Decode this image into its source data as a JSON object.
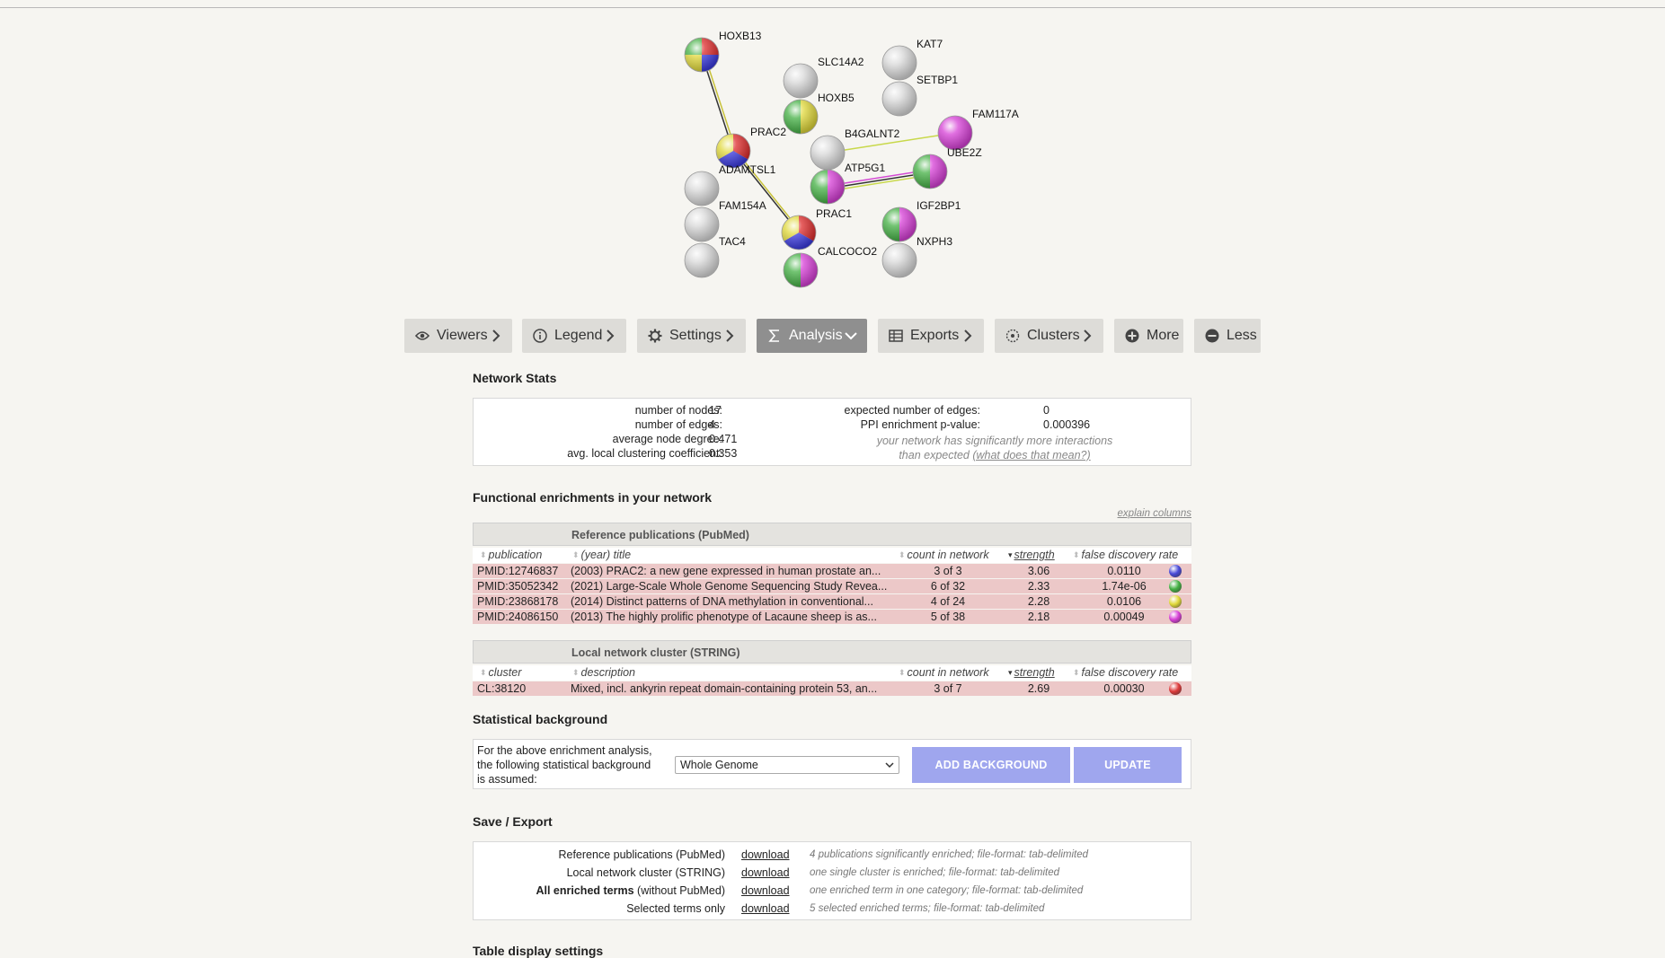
{
  "network": {
    "nodes": [
      {
        "label": "HOXB13",
        "colors": [
          "#dd2b2b",
          "#3b3be0",
          "#e0d83a",
          "#44b044"
        ]
      },
      {
        "label": "SLC14A2",
        "colors": [
          "#d9d9d9"
        ]
      },
      {
        "label": "HOXB5",
        "colors": [
          "#e0d83a",
          "#44b044"
        ]
      },
      {
        "label": "KAT7",
        "colors": [
          "#d9d9d9"
        ]
      },
      {
        "label": "SETBP1",
        "colors": [
          "#d9d9d9"
        ]
      },
      {
        "label": "FAM117A",
        "colors": [
          "#d63fd6"
        ]
      },
      {
        "label": "PRAC2",
        "colors": [
          "#dd2b2b",
          "#3b3be0",
          "#e0d83a"
        ]
      },
      {
        "label": "B4GALNT2",
        "colors": [
          "#d9d9d9"
        ]
      },
      {
        "label": "UBE2Z",
        "colors": [
          "#d63fd6",
          "#44b044"
        ]
      },
      {
        "label": "ADAMTSL1",
        "colors": [
          "#d9d9d9"
        ]
      },
      {
        "label": "ATP5G1",
        "colors": [
          "#d63fd6",
          "#44b044"
        ]
      },
      {
        "label": "FAM154A",
        "colors": [
          "#d9d9d9"
        ]
      },
      {
        "label": "PRAC1",
        "colors": [
          "#dd2b2b",
          "#3b3be0",
          "#e0d83a"
        ]
      },
      {
        "label": "IGF2BP1",
        "colors": [
          "#d63fd6",
          "#44b044"
        ]
      },
      {
        "label": "TAC4",
        "colors": [
          "#d9d9d9"
        ]
      },
      {
        "label": "CALCOCO2",
        "colors": [
          "#d63fd6",
          "#44b044"
        ]
      },
      {
        "label": "NXPH3",
        "colors": [
          "#d9d9d9"
        ]
      }
    ]
  },
  "tabs": [
    {
      "label": "Viewers",
      "icon": "eye-icon"
    },
    {
      "label": "Legend",
      "icon": "info-icon"
    },
    {
      "label": "Settings",
      "icon": "gear-icon"
    },
    {
      "label": "Analysis",
      "icon": "sigma-icon"
    },
    {
      "label": "Exports",
      "icon": "table-icon"
    },
    {
      "label": "Clusters",
      "icon": "cluster-icon"
    },
    {
      "label": "More",
      "icon": "plus-circle-icon"
    },
    {
      "label": "Less",
      "icon": "minus-circle-icon"
    }
  ],
  "network_stats": {
    "title": "Network Stats",
    "left": [
      {
        "label": "number of nodes:",
        "value": "17"
      },
      {
        "label": "number of edges:",
        "value": "4"
      },
      {
        "label": "average node degree:",
        "value": "0.471"
      },
      {
        "label": "avg. local clustering coefficient:",
        "value": "0.353"
      }
    ],
    "right": [
      {
        "label": "expected number of edges:",
        "value": "0"
      },
      {
        "label": "PPI enrichment p-value:",
        "value": "0.000396"
      }
    ],
    "note_line1": "your network has significantly more interactions",
    "note_line2": "than expected",
    "note_link": "(what does that mean?)"
  },
  "enrichment": {
    "title": "Functional enrichments in your network",
    "explain": "explain columns",
    "publications": {
      "header": "Reference publications (PubMed)",
      "columns": [
        "publication",
        "(year) title",
        "count in network",
        "strength",
        "false discovery rate"
      ],
      "rows": [
        {
          "id": "PMID:12746837",
          "title": "(2003) PRAC2: a new gene expressed in human prostate an...",
          "count": "3 of 3",
          "strength": "3.06",
          "fdr": "0.0110",
          "color": "#4a4ad8"
        },
        {
          "id": "PMID:35052342",
          "title": "(2021) Large-Scale Whole Genome Sequencing Study Revea...",
          "count": "6 of 32",
          "strength": "2.33",
          "fdr": "1.74e-06",
          "color": "#44b044"
        },
        {
          "id": "PMID:23868178",
          "title": "(2014) Distinct patterns of DNA methylation in conventional...",
          "count": "4 of 24",
          "strength": "2.28",
          "fdr": "0.0106",
          "color": "#e0d83a"
        },
        {
          "id": "PMID:24086150",
          "title": "(2013) The highly prolific phenotype of Lacaune sheep is as...",
          "count": "5 of 38",
          "strength": "2.18",
          "fdr": "0.00049",
          "color": "#d63fd6"
        }
      ]
    },
    "clusters": {
      "header": "Local network cluster (STRING)",
      "columns": [
        "cluster",
        "description",
        "count in network",
        "strength",
        "false discovery rate"
      ],
      "rows": [
        {
          "id": "CL:38120",
          "title": "Mixed, incl. ankyrin repeat domain-containing protein 53, an...",
          "count": "3 of 7",
          "strength": "2.69",
          "fdr": "0.00030",
          "color": "#dd3a3a"
        }
      ]
    }
  },
  "background": {
    "title": "Statistical background",
    "text_lines": [
      "For the above enrichment analysis,",
      "the following statistical background",
      "is assumed:"
    ],
    "selected": "Whole Genome",
    "add_button": "ADD BACKGROUND",
    "update_button": "UPDATE"
  },
  "save_export": {
    "title": "Save / Export",
    "rows": [
      {
        "label": "Reference publications (PubMed)",
        "bold": "",
        "link": "download",
        "note": "4 publications significantly enriched; file-format: tab-delimited"
      },
      {
        "label": "Local network cluster (STRING)",
        "bold": "",
        "link": "download",
        "note": "one single cluster is enriched; file-format: tab-delimited"
      },
      {
        "label": " (without PubMed)",
        "bold": "All enriched terms",
        "link": "download",
        "note": "one enriched term in one category; file-format: tab-delimited"
      },
      {
        "label": "Selected terms only",
        "bold": "",
        "link": "download",
        "note": "5 selected enriched terms; file-format: tab-delimited"
      }
    ]
  },
  "table_display": {
    "title": "Table display settings"
  }
}
